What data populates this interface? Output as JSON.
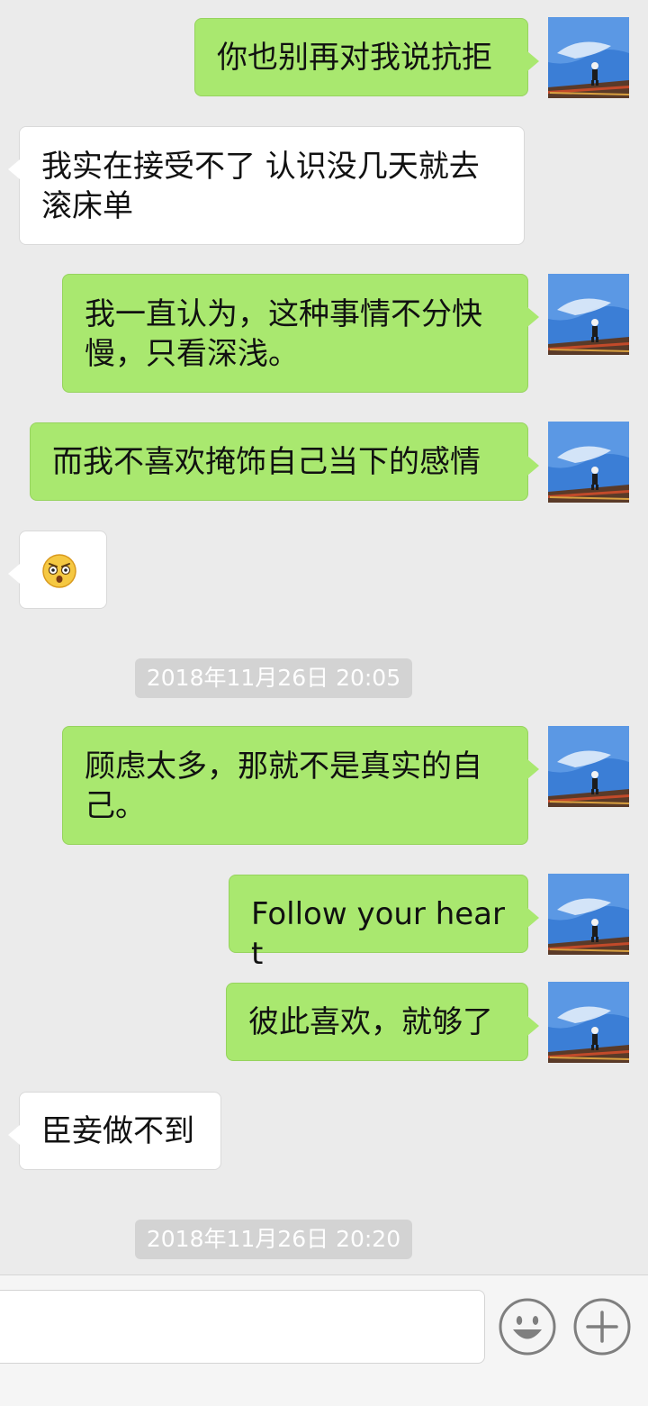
{
  "messages": [
    {
      "side": "me",
      "text": "你也别再对我说抗拒"
    },
    {
      "side": "them",
      "text": "我实在接受不了 认识没几天就去滚床单"
    },
    {
      "side": "me",
      "text": "我一直认为，这种事情不分快慢，只看深浅。"
    },
    {
      "side": "me",
      "text": "而我不喜欢掩饰自己当下的感情"
    },
    {
      "side": "them",
      "emoji": "shocked-face-emoji"
    },
    {
      "side": "me",
      "text": "顾虑太多，那就不是真实的自己。"
    },
    {
      "side": "me",
      "text": "Follow your heart"
    },
    {
      "side": "me",
      "text": "彼此喜欢，就够了"
    },
    {
      "side": "them",
      "text": "臣妾做不到"
    }
  ],
  "timestamps": [
    "2018年11月26日 20:05",
    "2018年11月26日 20:20"
  ],
  "input_bar": {
    "placeholder": "",
    "icons": [
      "emoji-icon",
      "plus-icon"
    ]
  },
  "colors": {
    "background": "#ebebeb",
    "my_bubble": "#a9e86f",
    "their_bubble": "#ffffff",
    "timestamp_bg": "#d3d3d3"
  }
}
